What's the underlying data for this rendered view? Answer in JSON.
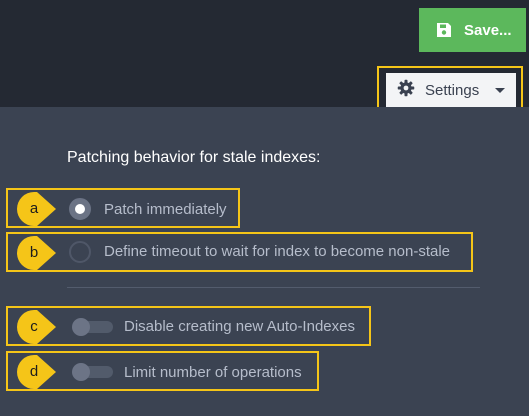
{
  "toolbar": {
    "save_label": "Save...",
    "settings_label": "Settings"
  },
  "patching": {
    "heading": "Patching behavior for stale indexes:",
    "options": [
      {
        "badge": "a",
        "label": "Patch immediately",
        "selected": true
      },
      {
        "badge": "b",
        "label": "Define timeout to wait for index to become non-stale",
        "selected": false
      }
    ]
  },
  "toggles": [
    {
      "badge": "c",
      "label": "Disable creating new Auto-Indexes",
      "enabled": false
    },
    {
      "badge": "d",
      "label": "Limit number of operations",
      "enabled": false
    }
  ],
  "colors": {
    "highlight": "#f5c518",
    "save_button": "#5cb85c",
    "panel": "#3b4352",
    "background": "#242933"
  },
  "icons": {
    "save": "floppy-disk-icon",
    "settings": "gear-icon",
    "dropdown": "caret-down-icon"
  }
}
